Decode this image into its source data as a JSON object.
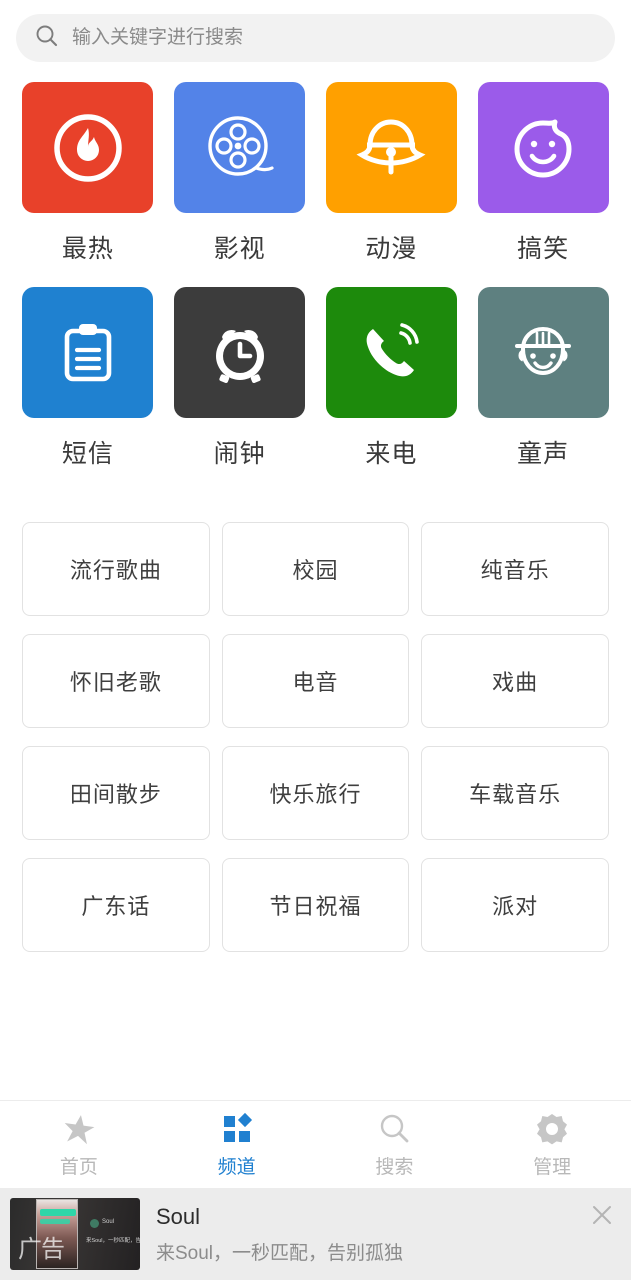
{
  "search": {
    "placeholder": "输入关键字进行搜索",
    "value": "",
    "icon": "search-icon"
  },
  "tiles": [
    {
      "label": "最热",
      "icon": "fire-circle-icon",
      "color": "#e8412a"
    },
    {
      "label": "影视",
      "icon": "film-reel-icon",
      "color": "#5383e8"
    },
    {
      "label": "动漫",
      "icon": "bell-cartoon-icon",
      "color": "#ffa000"
    },
    {
      "label": "搞笑",
      "icon": "smiley-face-icon",
      "color": "#9b5bea"
    },
    {
      "label": "短信",
      "icon": "clipboard-note-icon",
      "color": "#1f81d0"
    },
    {
      "label": "闹钟",
      "icon": "alarm-clock-icon",
      "color": "#3c3c3c"
    },
    {
      "label": "来电",
      "icon": "ringing-phone-icon",
      "color": "#1d8a0c"
    },
    {
      "label": "童声",
      "icon": "child-face-icon",
      "color": "#5e8080"
    }
  ],
  "chips": [
    "流行歌曲",
    "校园",
    "纯音乐",
    "怀旧老歌",
    "电音",
    "戏曲",
    "田间散步",
    "快乐旅行",
    "车载音乐",
    "广东话",
    "节日祝福",
    "派对"
  ],
  "nav": {
    "active_index": 1,
    "active_color": "#2080d0",
    "inactive_color": "#bdbdbd",
    "items": [
      {
        "label": "首页",
        "icon": "star-icon"
      },
      {
        "label": "频道",
        "icon": "grid-squares-icon"
      },
      {
        "label": "搜索",
        "icon": "search-icon"
      },
      {
        "label": "管理",
        "icon": "gear-icon"
      }
    ]
  },
  "ad": {
    "title": "Soul",
    "subtitle": "来Soul，一秒匹配，告别孤独",
    "badge": "广告",
    "thumb_logo_text": "Soul",
    "thumb_copy": "来Soul，一秒匹配，告别孤独",
    "close_icon": "close-icon"
  }
}
